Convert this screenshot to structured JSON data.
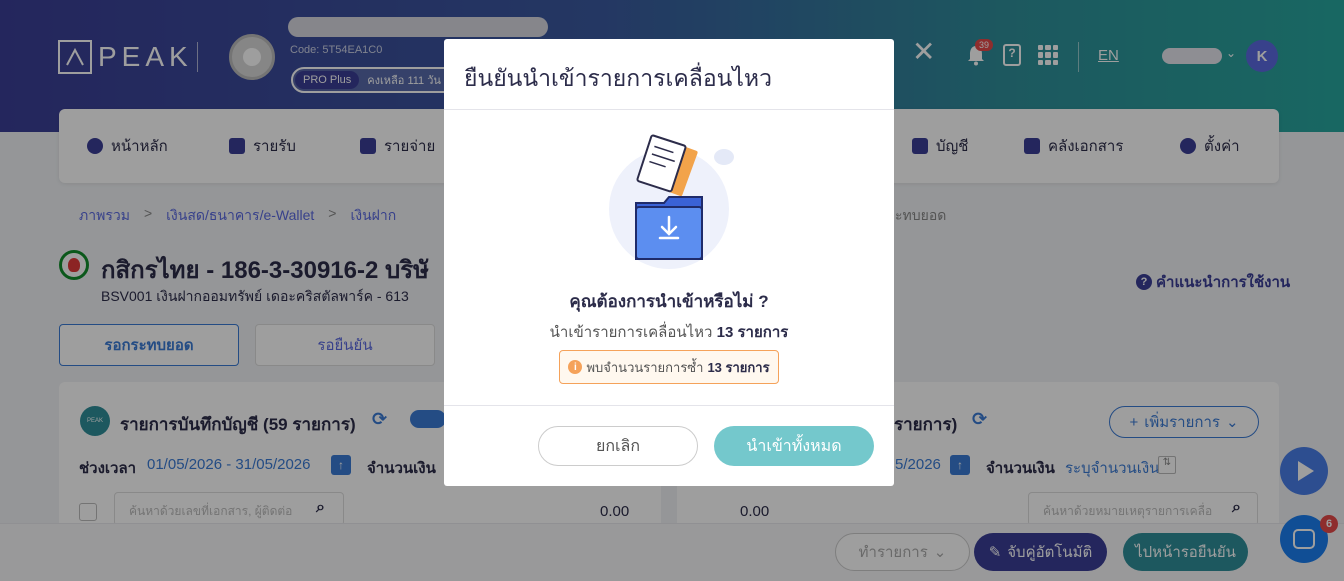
{
  "header": {
    "logo_text": "PEAK",
    "company_code": "Code: 5T54EA1C0",
    "plan_badge": "PRO Plus",
    "plan_remaining": "คงเหลือ 111 วัน",
    "notification_count": "39",
    "language": "EN",
    "user_initial": "K"
  },
  "nav": {
    "items": [
      {
        "label": "หน้าหลัก",
        "icon": "dashboard-icon"
      },
      {
        "label": "รายรับ",
        "icon": "income-icon"
      },
      {
        "label": "รายจ่าย",
        "icon": "expense-icon"
      },
      {
        "label": "บัญชี",
        "icon": "book-icon"
      },
      {
        "label": "คลังเอกสาร",
        "icon": "folder-icon"
      },
      {
        "label": "ตั้งค่า",
        "icon": "gear-icon"
      }
    ]
  },
  "breadcrumb": {
    "items": [
      "ภาพรวม",
      "เงินสด/ธนาคาร/e-Wallet",
      "เงินฝาก"
    ],
    "last": "ะทบยอด"
  },
  "account": {
    "title": "กสิกรไทย - 186-3-30916-2 บริษั",
    "subtitle": "BSV001 เงินฝากออมทรัพย์ เดอะคริสตัลพาร์ค - 613",
    "guide_link": "คำแนะนำการใช้งาน"
  },
  "tabs": {
    "active": "รอกระทบยอด",
    "inactive": "รอยืนยัน"
  },
  "left_panel": {
    "title": "รายการบันทึกบัญชี (59 รายการ)",
    "badge": "PEAK",
    "period_label": "ช่วงเวลา",
    "period_value": "01/05/2026 - 31/05/2026",
    "amount_label": "จำนวนเงิน",
    "search_placeholder": "ค้นหาด้วยเลขที่เอกสาร, ผู้ติดต่อ",
    "total": "0.00"
  },
  "right_panel": {
    "title": "รายการ)",
    "add_button": "เพิ่มรายการ",
    "period_value": "5/2026",
    "amount_label": "จำนวนเงิน",
    "amount_placeholder": "ระบุจำนวนเงิน",
    "search_placeholder": "ค้นหาด้วยหมายเหตุรายการเคลื่อ",
    "total": "0.00"
  },
  "bottom_bar": {
    "items_button": "ทำรายการ",
    "auto_match_button": "จับคู่อัตโนมัติ",
    "confirm_button": "ไปหน้ารอยืนยัน"
  },
  "chat_badge": "6",
  "modal": {
    "title": "ยืนยันนำเข้ารายการเคลื่อนไหว",
    "question": "คุณต้องการนำเข้าหรือไม่ ?",
    "desc_prefix": "นำเข้ารายการเคลื่อนไหว",
    "desc_count": "13 รายการ",
    "warning_prefix": "พบจำนวนรายการซ้ำ",
    "warning_count": "13 รายการ",
    "cancel_label": "ยกเลิก",
    "import_all_label": "นำเข้าทั้งหมด"
  },
  "colors": {
    "primary": "#3b3e96",
    "accent_blue": "#3b7bd5",
    "teal": "#74c8cc",
    "warning": "#f5a25a"
  }
}
